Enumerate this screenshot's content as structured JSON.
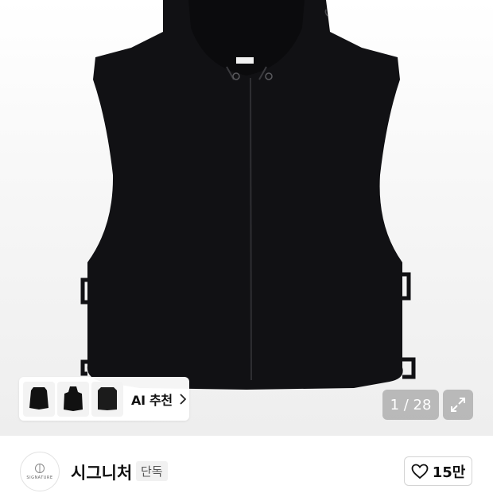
{
  "ai_recommend": {
    "label": "AI 추천",
    "thumbnails": [
      "vest-thumb-1",
      "hooded-vest-thumb",
      "vest-thumb-3"
    ]
  },
  "gallery": {
    "counter": "1 / 28"
  },
  "brand": {
    "logo_text": "SIGNATURE",
    "name": "시그니처",
    "badge": "단독"
  },
  "like": {
    "count": "15만"
  },
  "colors": {
    "garment": "#111114",
    "overlay": "#8c8c8c",
    "border": "#d4d4d4"
  }
}
